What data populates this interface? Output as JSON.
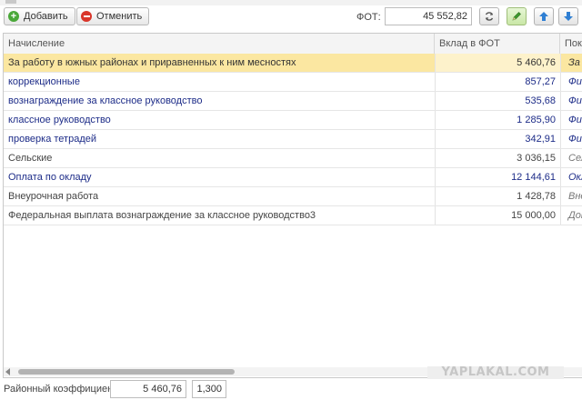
{
  "toolbar": {
    "add_label": "Добавить",
    "cancel_label": "Отменить",
    "fot_label": "ФОТ:",
    "fot_value": "45 552,82"
  },
  "icons": {
    "add": "plus-circle-icon",
    "cancel": "minus-circle-icon",
    "refresh": "refresh-icon",
    "edit": "pencil-icon",
    "move_up": "arrow-up-icon",
    "move_down": "arrow-down-icon"
  },
  "colors": {
    "selected_row": "#fbe7a1",
    "link_text": "#1d2c88",
    "add_icon": "#4aa839",
    "cancel_icon": "#d9352a",
    "arrow_icon": "#2f7fd3",
    "pencil_icon": "#3f9a2e"
  },
  "table": {
    "columns": [
      "Начисление",
      "Вклад в ФОТ",
      "Пока"
    ],
    "rows": [
      {
        "name": "За работу в южных районах и приравненных к ним месностях",
        "amount": "5 460,76",
        "extra": "За р",
        "style": "selected"
      },
      {
        "name": "коррекционные",
        "amount": "857,27",
        "extra": "Фик",
        "style": "blue"
      },
      {
        "name": "вознаграждение за классное руководство",
        "amount": "535,68",
        "extra": "Фик",
        "style": "blue"
      },
      {
        "name": "классное руководство",
        "amount": "1 285,90",
        "extra": "Фик",
        "style": "blue"
      },
      {
        "name": "проверка тетрадей",
        "amount": "342,91",
        "extra": "Фик",
        "style": "blue"
      },
      {
        "name": "Сельские",
        "amount": "3 036,15",
        "extra": "Сел",
        "style": "gray"
      },
      {
        "name": "Оплата по окладу",
        "amount": "12 144,61",
        "extra": "Окл",
        "style": "blue"
      },
      {
        "name": "Внеурочная работа",
        "amount": "1 428,78",
        "extra": "Внеу",
        "style": "gray"
      },
      {
        "name": "Федеральная выплата вознаграждение за классное руководство3",
        "amount": "15 000,00",
        "extra": "Доп",
        "style": "gray"
      }
    ]
  },
  "watermark": "YAPLAKAL.COM",
  "footer": {
    "label": "Районный коэффициен...",
    "amount": "5 460,76",
    "coefficient": "1,300"
  }
}
